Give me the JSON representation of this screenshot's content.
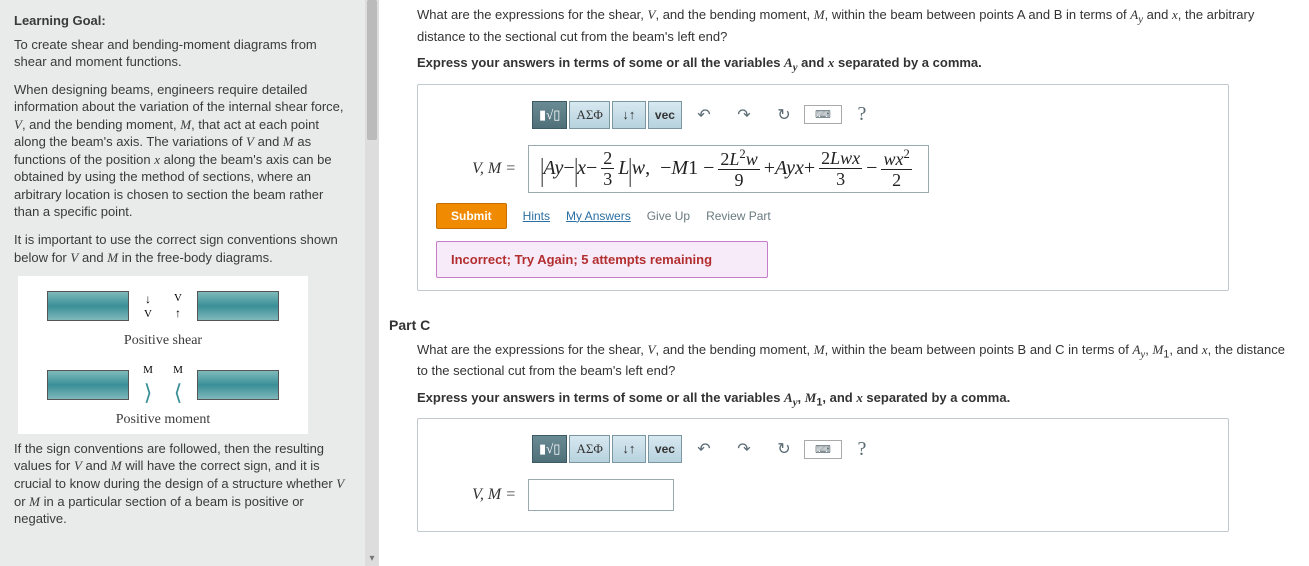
{
  "sidebar": {
    "goal_title": "Learning Goal:",
    "goal_text": "To create shear and bending-moment diagrams from shear and moment functions.",
    "para1_a": "When designing beams, engineers require detailed information about the variation of the internal shear force, ",
    "para1_b": ", and the bending moment, ",
    "para1_c": ", that act at each point along the beam's axis. The variations of ",
    "para1_d": " and ",
    "para1_e": " as functions of the position ",
    "para1_f": " along the beam's axis can be obtained by using the method of sections, where an arbitrary location is chosen to section the beam rather than a specific point.",
    "para2_a": "It is important to use the correct sign conventions shown below for ",
    "para2_b": " and ",
    "para2_c": " in the free-body diagrams.",
    "pos_shear": "Positive shear",
    "pos_moment": "Positive moment",
    "para3_a": "If the sign conventions are followed, then the resulting values for ",
    "para3_b": " and ",
    "para3_c": " will have the correct sign, and it is crucial to know during the design of a structure whether ",
    "para3_d": " or ",
    "para3_e": " in a particular section of a beam is positive or negative."
  },
  "partB": {
    "question_a": "What are the expressions for the shear, ",
    "question_b": ", and the bending moment, ",
    "question_c": ", within the beam between points A and B in terms of ",
    "question_d": " and ",
    "question_e": ", the arbitrary distance to the sectional cut from the beam's left end?",
    "instruct_a": "Express your answers in terms of some or all the variables ",
    "instruct_b": " and ",
    "instruct_c": " separated by a comma.",
    "eq_label": "V, M =",
    "submit": "Submit",
    "hints": "Hints",
    "myans": "My Answers",
    "giveup": "Give Up",
    "review": "Review Part",
    "feedback": "Incorrect; Try Again; 5 attempts remaining"
  },
  "partC": {
    "header": "Part C",
    "question_a": "What are the expressions for the shear, ",
    "question_b": ", and the bending moment, ",
    "question_c": ", within the beam between points B and C in terms of ",
    "question_d": ", ",
    "question_e": ", and ",
    "question_f": ", the distance to the sectional cut from the beam's left end?",
    "instruct_a": "Express your answers in terms of some or all the variables ",
    "instruct_b": ", ",
    "instruct_c": ", and ",
    "instruct_d": " separated by a comma.",
    "eq_label": "V, M ="
  },
  "toolbar": {
    "panel": "▮√▯",
    "greek": "ΑΣΦ",
    "updown": "↓↑",
    "vec": "vec",
    "undo": "↶",
    "redo": "↷",
    "reset": "↻",
    "keyboard": "⌨",
    "help": "?"
  },
  "chart_data": {
    "type": "table",
    "title": "Student-entered answer for V, M (Part B)",
    "series": [
      {
        "name": "V",
        "expression": "Ay − |x − (2/3)L| w"
      },
      {
        "name": "M",
        "expression": "− M1 − (2 L^2 w)/9 + Ay x + (2 L w x)/3 − (w x^2)/2"
      }
    ]
  }
}
